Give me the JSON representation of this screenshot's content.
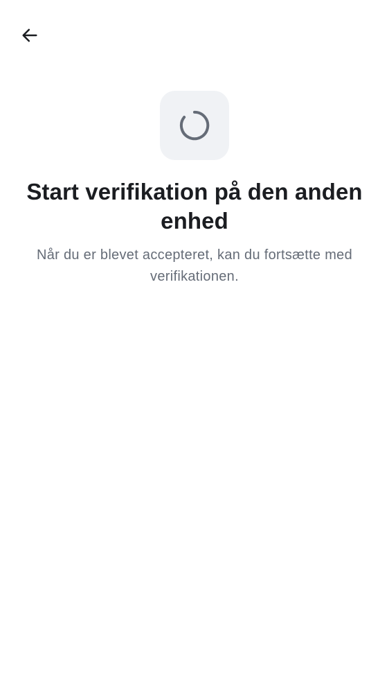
{
  "header": {
    "back_icon": "arrow-left-icon"
  },
  "main": {
    "spinner_icon": "loading-spinner-icon",
    "title": "Start verifikation på den anden enhed",
    "subtitle": "Når du er blevet accepteret, kan du fortsætte med verifikationen."
  },
  "colors": {
    "background": "#ffffff",
    "title": "#1b1d21",
    "subtitle": "#656c77",
    "spinner_tile": "#f0f2f5",
    "spinner": "#656c77"
  }
}
